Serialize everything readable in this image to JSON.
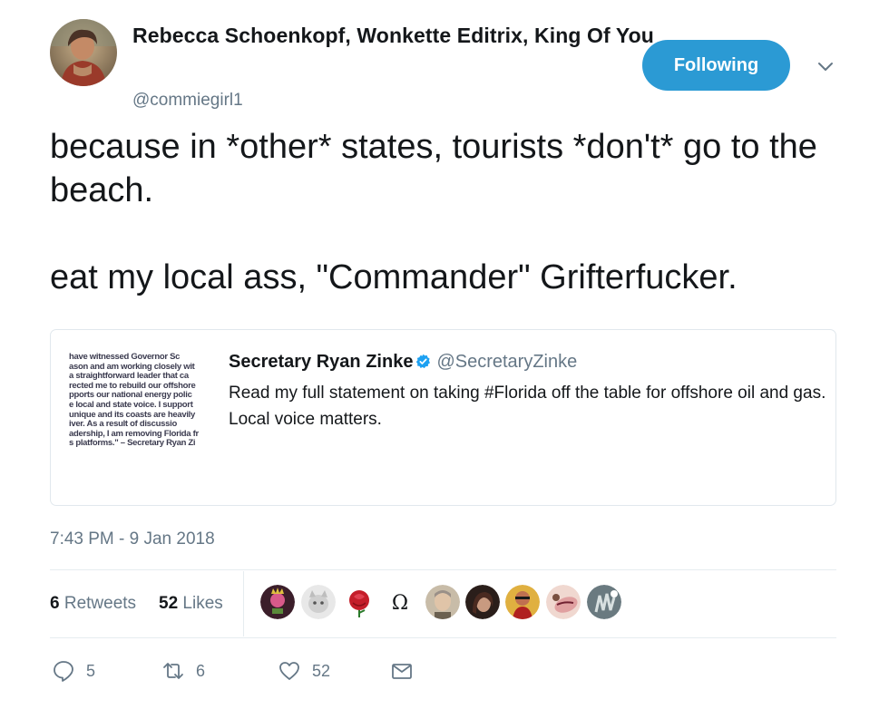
{
  "author": {
    "display_name": "Rebecca Schoenkopf, Wonkette Editrix, King Of You",
    "handle": "@commiegirl1",
    "avatar_icon": "profile-photo"
  },
  "follow_button": {
    "label": "Following",
    "color": "#2b9ad4"
  },
  "tweet": {
    "text": "because in *other* states, tourists *don't* go to the beach.\n\neat my local ass, \"Commander\" Grifterfucker."
  },
  "quoted_tweet": {
    "display_name": "Secretary Ryan Zinke",
    "handle": "@SecretaryZinke",
    "verified": true,
    "text": "Read my full statement on taking #Florida off the table for offshore oil and gas. Local voice matters.",
    "thumbnail_lines": [
      " have witnessed Governor Sc",
      "ason and am working closely wit",
      " a straightforward leader that ca",
      "rected me to rebuild our offshore",
      "pports our national energy polic",
      "e local and state voice. I support",
      " unique and its coasts are heavily",
      "iver.  As a result of discussio",
      "adership, I am removing Florida fr",
      "s platforms.\" – Secretary Ryan Zi"
    ]
  },
  "timestamp": "7:43 PM - 9 Jan 2018",
  "stats": {
    "retweets_count": "6",
    "retweets_label": "Retweets",
    "likes_count": "52",
    "likes_label": "Likes"
  },
  "likers": [
    {
      "name": "liker-avatar-1",
      "color": "#5a2a3a"
    },
    {
      "name": "liker-avatar-2",
      "color": "#d8d8d8"
    },
    {
      "name": "liker-avatar-3",
      "color": "#c0202a"
    },
    {
      "name": "liker-avatar-4",
      "glyph": "Ω"
    },
    {
      "name": "liker-avatar-5",
      "color": "#b8a894"
    },
    {
      "name": "liker-avatar-6",
      "color": "#3a2a24"
    },
    {
      "name": "liker-avatar-7",
      "color": "#c04020"
    },
    {
      "name": "liker-avatar-8",
      "color": "#e8c8c0"
    },
    {
      "name": "liker-avatar-9",
      "color": "#8a9aa0"
    }
  ],
  "actions": {
    "reply_count": "5",
    "retweet_count": "6",
    "like_count": "52"
  },
  "colors": {
    "secondary_text": "#657786",
    "primary_text": "#14171a",
    "divider": "#e6ecf0"
  }
}
